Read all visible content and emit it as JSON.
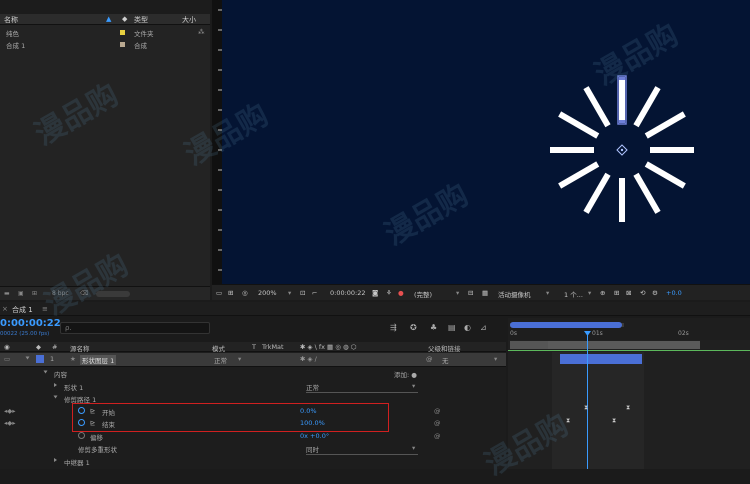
{
  "project": {
    "headers": {
      "name": "名称",
      "type": "类型",
      "size": "大小"
    },
    "rows": [
      {
        "name": "纯色",
        "type": "文件夹",
        "swatch_color": "#e8d040"
      },
      {
        "name": "合成 1",
        "type": "合成",
        "swatch_color": "#b9a890"
      }
    ],
    "footer_bpc": "8 bpc"
  },
  "viewer": {
    "zoom": "200%",
    "timecode": "0:00:00:22",
    "resolution": "(完整)",
    "camera": "活动摄像机",
    "views": "1 个...",
    "exposure": "+0.0",
    "bg_color": "#041433"
  },
  "timeline": {
    "tab_label": "合成 1",
    "timecode": "0:00:00:22",
    "fps": "00022 (25.00 fps)",
    "search_placeholder": "ρ.",
    "columns": {
      "num": "#",
      "source": "源名称",
      "mode": "模式",
      "t": "T",
      "trkmat": "TrkMat",
      "parent": "父级和链接"
    },
    "layer": {
      "num": "1",
      "name": "形状图层 1",
      "mode": "正常",
      "parent": "无"
    },
    "rows": [
      {
        "label": "内容",
        "extra": "添加: ●"
      },
      {
        "label": "形状 1",
        "value": "正常"
      },
      {
        "label": "修剪路径 1"
      },
      {
        "label": "开始",
        "value": "0.0%"
      },
      {
        "label": "结束",
        "value": "100.0%"
      },
      {
        "label": "偏移",
        "value": "0x +0.0°"
      },
      {
        "label": "修剪多重形状",
        "value": "同时"
      },
      {
        "label": "中继器 1"
      }
    ],
    "ruler": {
      "t0": "0s",
      "t1": "01s",
      "t2": "02s"
    }
  },
  "watermark": "漫品购"
}
